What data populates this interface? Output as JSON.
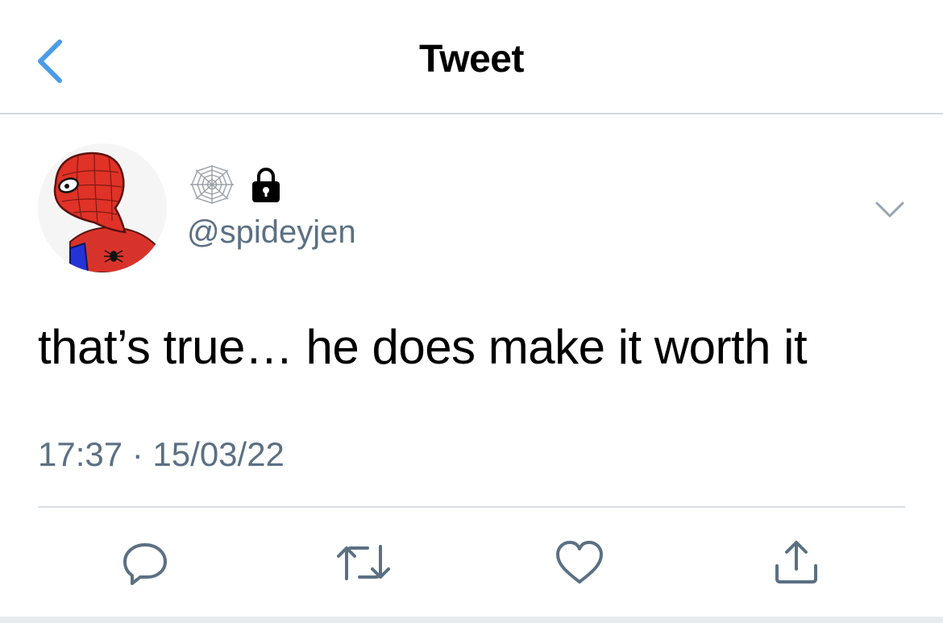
{
  "nav": {
    "title": "Tweet",
    "back_icon": "chevron-left-icon",
    "accent": "#4a9be8"
  },
  "tweet": {
    "handle": "@spideyjen",
    "name_icons": [
      "spiderweb-icon",
      "lock-icon"
    ],
    "text": "that’s true… he does make it worth it",
    "timestamp": "17:37 · 15/03/22",
    "more_icon": "chevron-down-icon"
  },
  "actions": {
    "icons": [
      "reply-icon",
      "retweet-icon",
      "like-icon",
      "share-icon"
    ],
    "icon_color": "#5b7083"
  },
  "colors": {
    "secondary_text": "#5b7083",
    "divider": "#d9dee3"
  }
}
